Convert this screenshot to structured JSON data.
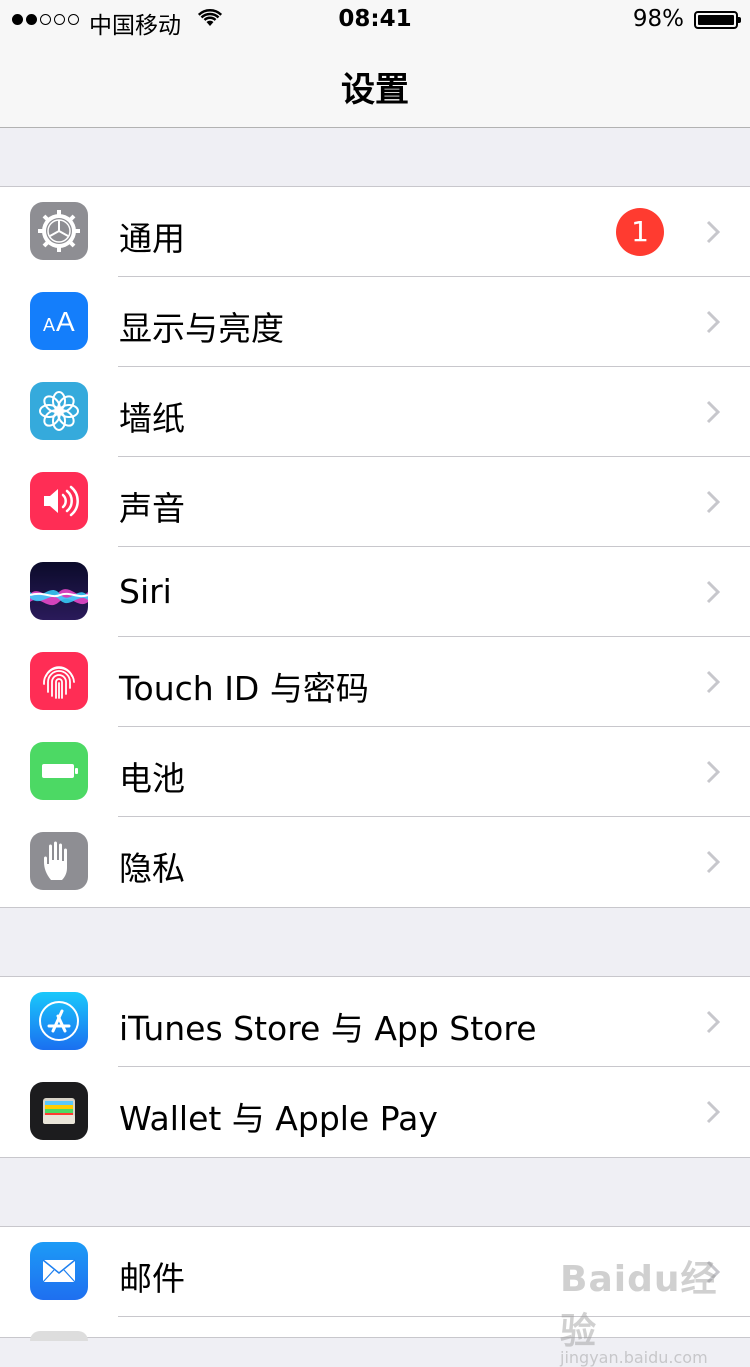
{
  "status_bar": {
    "carrier": "中国移动",
    "time": "08:41",
    "battery": "98%"
  },
  "nav": {
    "title": "设置"
  },
  "groups": [
    {
      "items": [
        {
          "label": "通用",
          "icon": "gear-icon",
          "color": "#8e8e93",
          "badge": "1"
        },
        {
          "label": "显示与亮度",
          "icon": "text-size-icon",
          "color": "#147efb"
        },
        {
          "label": "墙纸",
          "icon": "flower-icon",
          "color": "#35aadc"
        },
        {
          "label": "声音",
          "icon": "speaker-icon",
          "color": "#ff2d55"
        },
        {
          "label": "Siri",
          "icon": "siri-icon",
          "color": "#1a1a3a"
        },
        {
          "label": "Touch ID 与密码",
          "icon": "fingerprint-icon",
          "color": "#ff2d55"
        },
        {
          "label": "电池",
          "icon": "battery-icon",
          "color": "#4cd964"
        },
        {
          "label": "隐私",
          "icon": "hand-icon",
          "color": "#8e8e93"
        }
      ]
    },
    {
      "items": [
        {
          "label": "iTunes Store 与 App Store",
          "icon": "app-store-icon",
          "color": "#1a8cf0"
        },
        {
          "label": "Wallet 与 Apple Pay",
          "icon": "wallet-icon",
          "color": "#1c1c1e"
        }
      ]
    },
    {
      "items": [
        {
          "label": "邮件",
          "icon": "mail-icon",
          "color": "#1e90ff"
        }
      ]
    }
  ],
  "watermark": {
    "text": "Baidu经验",
    "sub": "jingyan.baidu.com"
  }
}
